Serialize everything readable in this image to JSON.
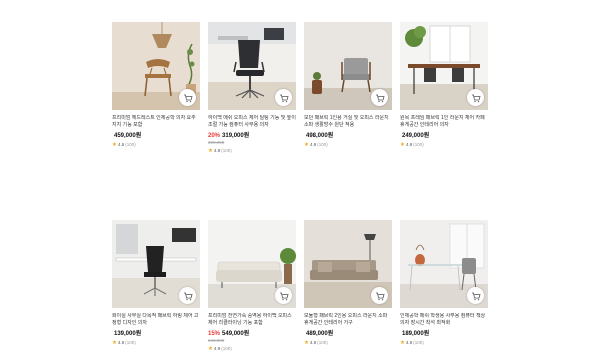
{
  "products": [
    {
      "title": "프리미엄 헤드레스트 인체공학 의자 요추지지 기능 포함",
      "price": "459,000원",
      "discount": "",
      "original": "",
      "rating": "4.5",
      "count": "(100)"
    },
    {
      "title": "하이백 메쉬 오피스 체어 틸팅 기능 및 높이 조절 가능 컴퓨터 사무용 의자",
      "price": "319,000원",
      "discount": "20%",
      "original": "399,000",
      "rating": "4.9",
      "count": "(100)"
    },
    {
      "title": "모던 패브릭 1인용 거실 및 오피스 라운지 소파 생활방수 원단 적용",
      "price": "498,000원",
      "discount": "",
      "original": "",
      "rating": "4.9",
      "count": "(100)"
    },
    {
      "title": "원목 프레임 패브릭 1인 라운지 체어 카페 휴게공간 인테리어 의자",
      "price": "249,000원",
      "discount": "",
      "original": "",
      "rating": "4.9",
      "count": "(100)"
    },
    {
      "title": "화이실 사무실 다목적 패브릭 하링 체어 고정형 디자인 의자",
      "price": "139,000원",
      "discount": "",
      "original": "",
      "rating": "4.9",
      "count": "(100)"
    },
    {
      "title": "프리미엄 천연가죽 중역용 하이백 오피스 체어 리클라이닝 기능 포함",
      "price": "549,000원",
      "discount": "15%",
      "original": "646,000",
      "rating": "4.9",
      "count": "(100)"
    },
    {
      "title": "모듈형 패브릭 2인용 오피스 라운지 소파 휴게공간 인테리어 가구",
      "price": "489,000원",
      "discount": "",
      "original": "",
      "rating": "4.9",
      "count": "(100)"
    },
    {
      "title": "인체공학 메쉬 학생용 사무용 컴퓨터 책상 의자 장시간 착석 최적화",
      "price": "189,000원",
      "discount": "",
      "original": "",
      "rating": "4.9",
      "count": "(100)"
    }
  ],
  "icons": {
    "cart": "cart-icon",
    "star": "star-icon"
  },
  "colors": {
    "discount": "#e53935",
    "star": "#f5a623"
  }
}
